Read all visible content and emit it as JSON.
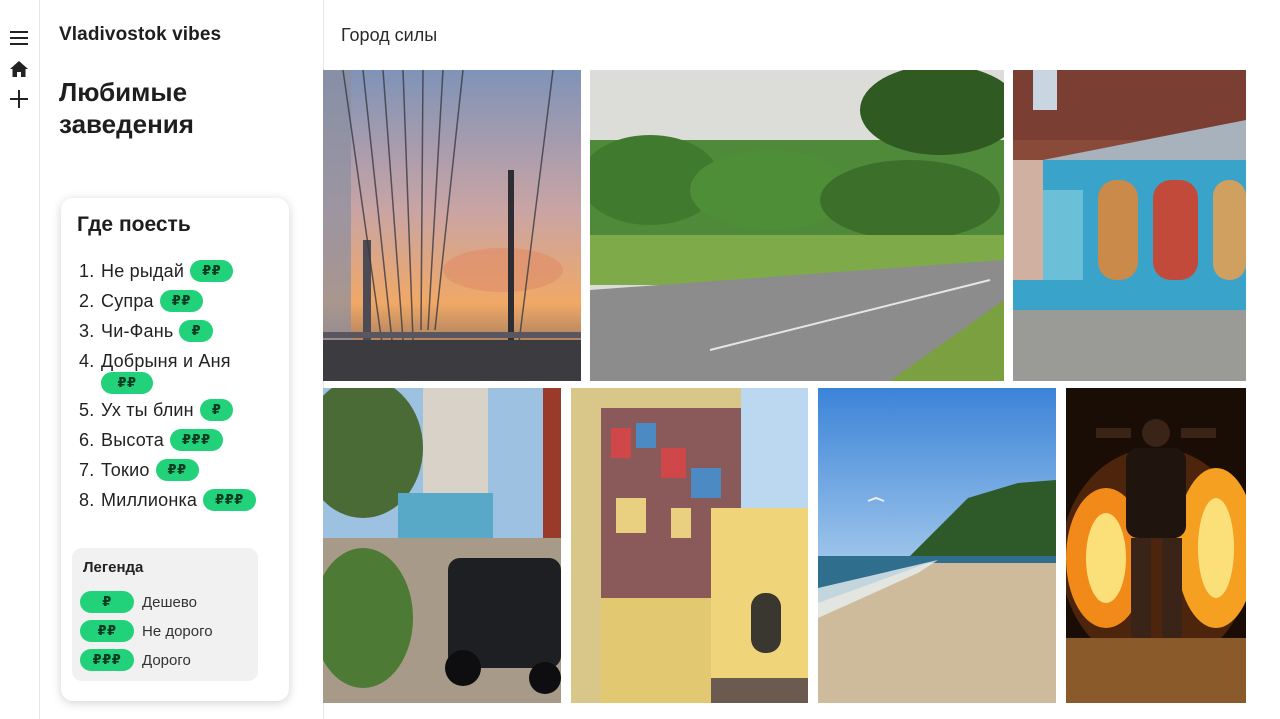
{
  "nav": {
    "icons": [
      "menu-icon",
      "home-icon",
      "plus-icon"
    ]
  },
  "sidebar": {
    "site_title": "Vladivostok vibes",
    "section_title": "Любимые заведения"
  },
  "card": {
    "title": "Где поесть",
    "items": [
      {
        "num": "1.",
        "name": "Не рыдай",
        "price": "₽₽"
      },
      {
        "num": "2.",
        "name": "Супра",
        "price": "₽₽"
      },
      {
        "num": "3.",
        "name": "Чи-Фань",
        "price": "₽"
      },
      {
        "num": "4.",
        "name": "Добрыня и Аня",
        "price": "₽₽"
      },
      {
        "num": "5.",
        "name": "Ух ты блин",
        "price": "₽"
      },
      {
        "num": "6.",
        "name": "Высота",
        "price": "₽₽₽"
      },
      {
        "num": "7.",
        "name": "Токио",
        "price": "₽₽"
      },
      {
        "num": "8.",
        "name": "Миллионка",
        "price": "₽₽₽"
      }
    ],
    "legend": {
      "title": "Легенда",
      "rows": [
        {
          "price": "₽",
          "label": "Дешево"
        },
        {
          "price": "₽₽",
          "label": "Не дорого"
        },
        {
          "price": "₽₽₽",
          "label": "Дорого"
        }
      ]
    }
  },
  "main": {
    "title": "Город силы"
  },
  "colors": {
    "badge": "#22d27a",
    "badge_text": "#0b3a22"
  }
}
